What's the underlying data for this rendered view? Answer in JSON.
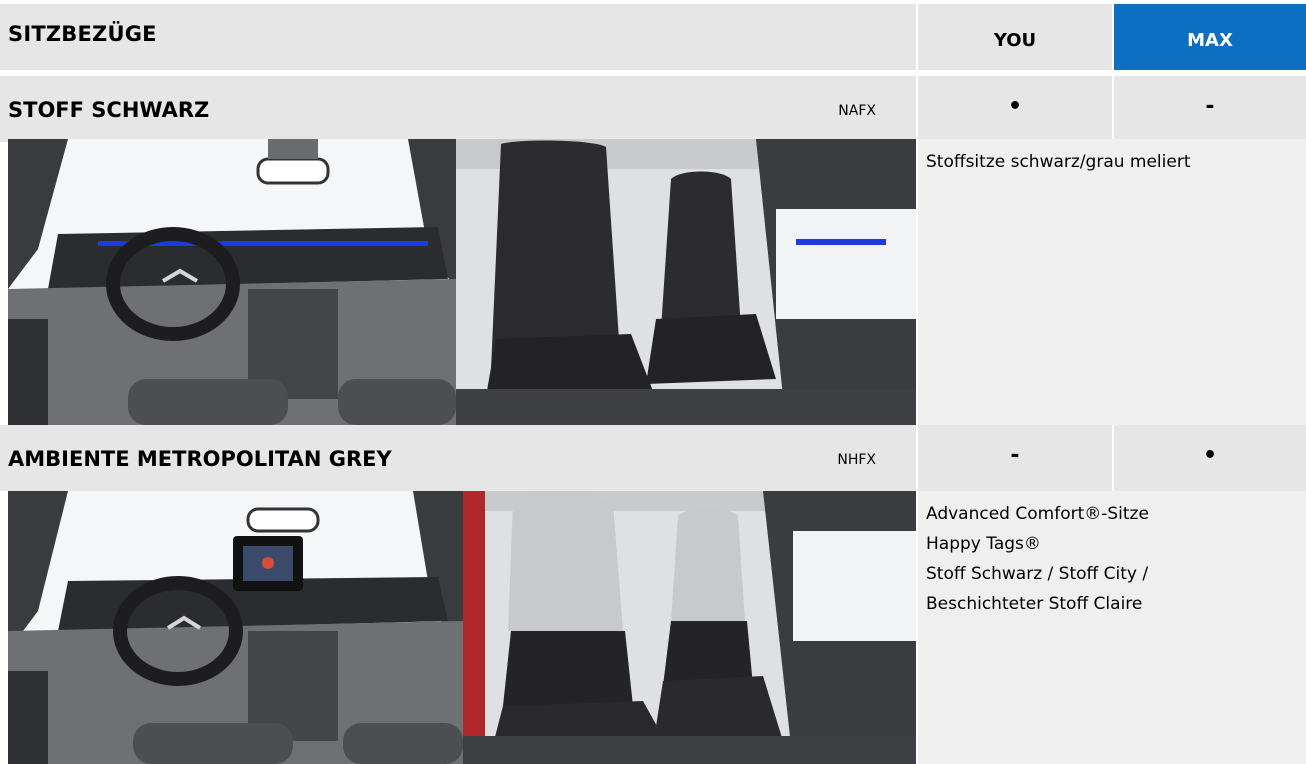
{
  "header": {
    "title": "SITZBEZÜGE",
    "col_you": "YOU",
    "col_max": "MAX",
    "accent_color": "#0c6fc2"
  },
  "options": [
    {
      "name": "STOFF SCHWARZ",
      "code": "NAFX",
      "you": "•",
      "max": "-",
      "description": [
        "Stoffsitze schwarz/grau meliert"
      ],
      "images": [
        "dashboard-photo",
        "black-fabric-seats-photo"
      ]
    },
    {
      "name": "AMBIENTE METROPOLITAN GREY",
      "code": "NHFX",
      "you": "-",
      "max": "•",
      "description": [
        "Advanced Comfort®-Sitze",
        "Happy Tags®",
        "Stoff Schwarz / Stoff City /",
        "Beschichteter Stoff Claire"
      ],
      "images": [
        "dashboard-touchscreen-photo",
        "grey-fabric-seats-photo"
      ]
    }
  ]
}
